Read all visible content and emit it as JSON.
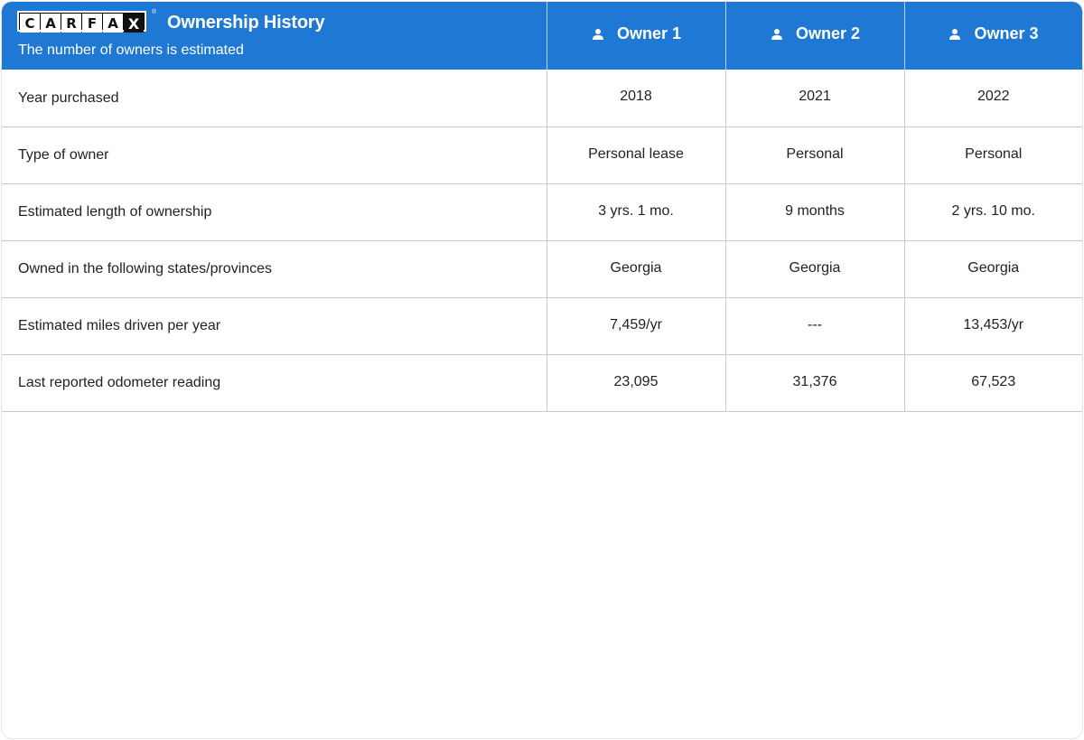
{
  "header": {
    "logo_letters": [
      "C",
      "A",
      "R",
      "F",
      "A",
      "X"
    ],
    "logo_reg": "®",
    "title": "Ownership History",
    "subtitle": "The number of owners is estimated",
    "owners": [
      {
        "label": "Owner 1",
        "icon": "person-icon"
      },
      {
        "label": "Owner 2",
        "icon": "person-icon"
      },
      {
        "label": "Owner 3",
        "icon": "person-icon"
      }
    ]
  },
  "rows": [
    {
      "label": "Year purchased",
      "values": [
        "2018",
        "2021",
        "2022"
      ]
    },
    {
      "label": "Type of owner",
      "values": [
        "Personal lease",
        "Personal",
        "Personal"
      ]
    },
    {
      "label": "Estimated length of ownership",
      "values": [
        "3 yrs. 1 mo.",
        "9 months",
        "2 yrs. 10 mo."
      ]
    },
    {
      "label": "Owned in the following states/provinces",
      "values": [
        "Georgia",
        "Georgia",
        "Georgia"
      ]
    },
    {
      "label": "Estimated miles driven per year",
      "values": [
        "7,459/yr",
        "---",
        "13,453/yr"
      ]
    },
    {
      "label": "Last reported odometer reading",
      "values": [
        "23,095",
        "31,376",
        "67,523"
      ]
    }
  ],
  "colors": {
    "header_bg": "#1e78d4",
    "text": "#222222",
    "divider": "#c9c9c9"
  }
}
